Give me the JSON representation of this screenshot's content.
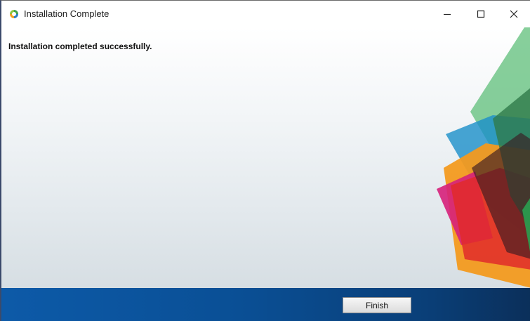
{
  "window": {
    "title": "Installation Complete",
    "icon": "installer-app-icon"
  },
  "controls": {
    "minimize_icon": "minimize-icon",
    "maximize_icon": "maximize-icon",
    "close_icon": "close-icon"
  },
  "content": {
    "message": "Installation completed successfully."
  },
  "footer": {
    "finish_label": "Finish"
  },
  "colors": {
    "footer_blue": "#0a4f95",
    "decor_green": "#5fbf7a",
    "decor_orange": "#f39a1f",
    "decor_red": "#e02a2a",
    "decor_blue": "#1a8fc9",
    "decor_magenta": "#d6207a",
    "decor_dark": "#3a1a22"
  }
}
